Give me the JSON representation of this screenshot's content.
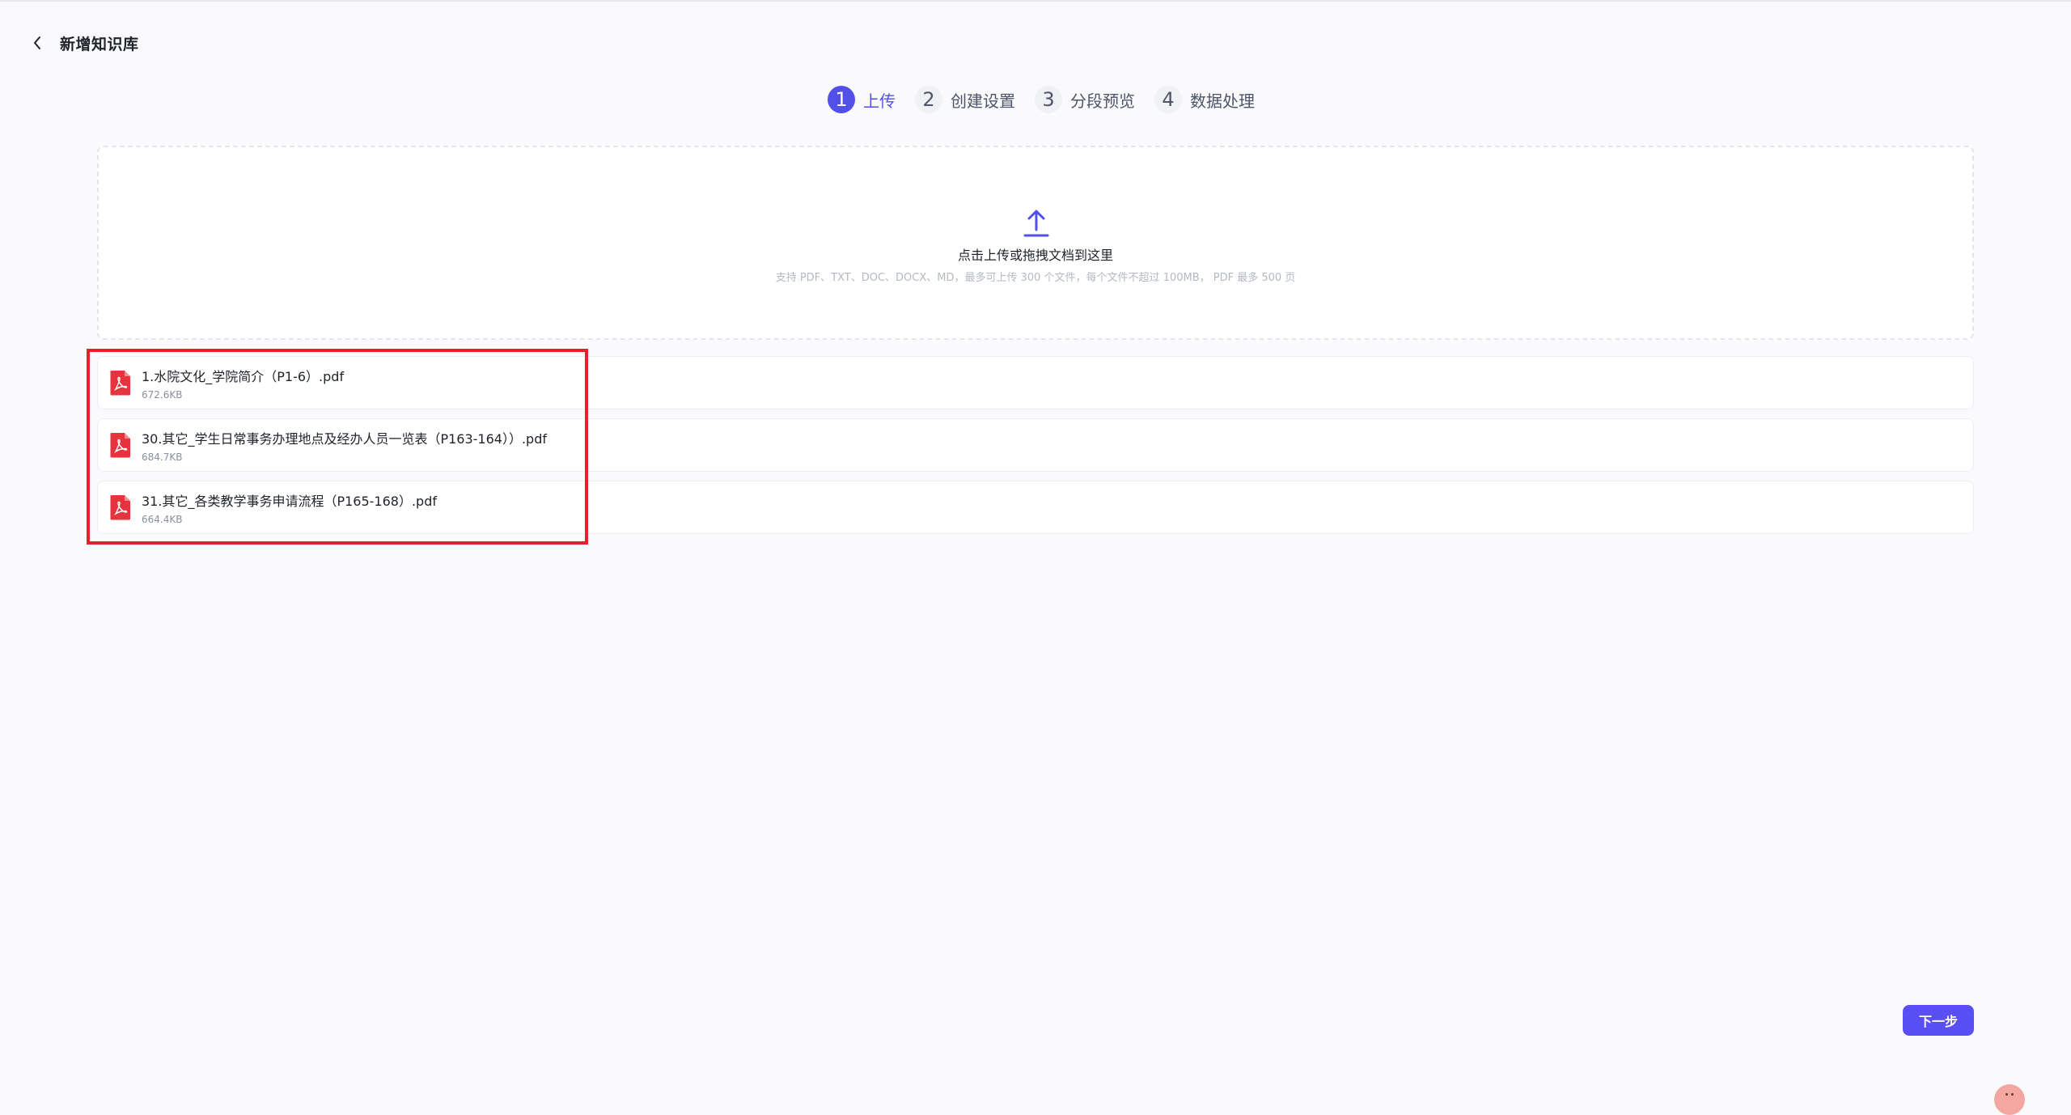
{
  "header": {
    "title": "新增知识库"
  },
  "steps": [
    {
      "num": "1",
      "label": "上传",
      "active": true
    },
    {
      "num": "2",
      "label": "创建设置",
      "active": false
    },
    {
      "num": "3",
      "label": "分段预览",
      "active": false
    },
    {
      "num": "4",
      "label": "数据处理",
      "active": false
    }
  ],
  "upload": {
    "title": "点击上传或拖拽文档到这里",
    "hint": "支持 PDF、TXT、DOC、DOCX、MD，最多可上传 300 个文件，每个文件不超过 100MB， PDF 最多 500 页"
  },
  "files": [
    {
      "name": "1.水院文化_学院简介（P1-6）.pdf",
      "size": "672.6KB"
    },
    {
      "name": "30.其它_学生日常事务办理地点及经办人员一览表（P163-164））.pdf",
      "size": "684.7KB"
    },
    {
      "name": "31.其它_各类教学事务申请流程（P165-168）.pdf",
      "size": "664.4KB"
    }
  ],
  "footer": {
    "next_label": "下一步"
  },
  "colors": {
    "accent": "#5350e8",
    "highlight": "#e8202b",
    "pdf_red": "#e5343d"
  },
  "icons": {
    "back": "chevron-left-icon",
    "upload": "upload-icon",
    "file": "pdf-file-icon"
  }
}
